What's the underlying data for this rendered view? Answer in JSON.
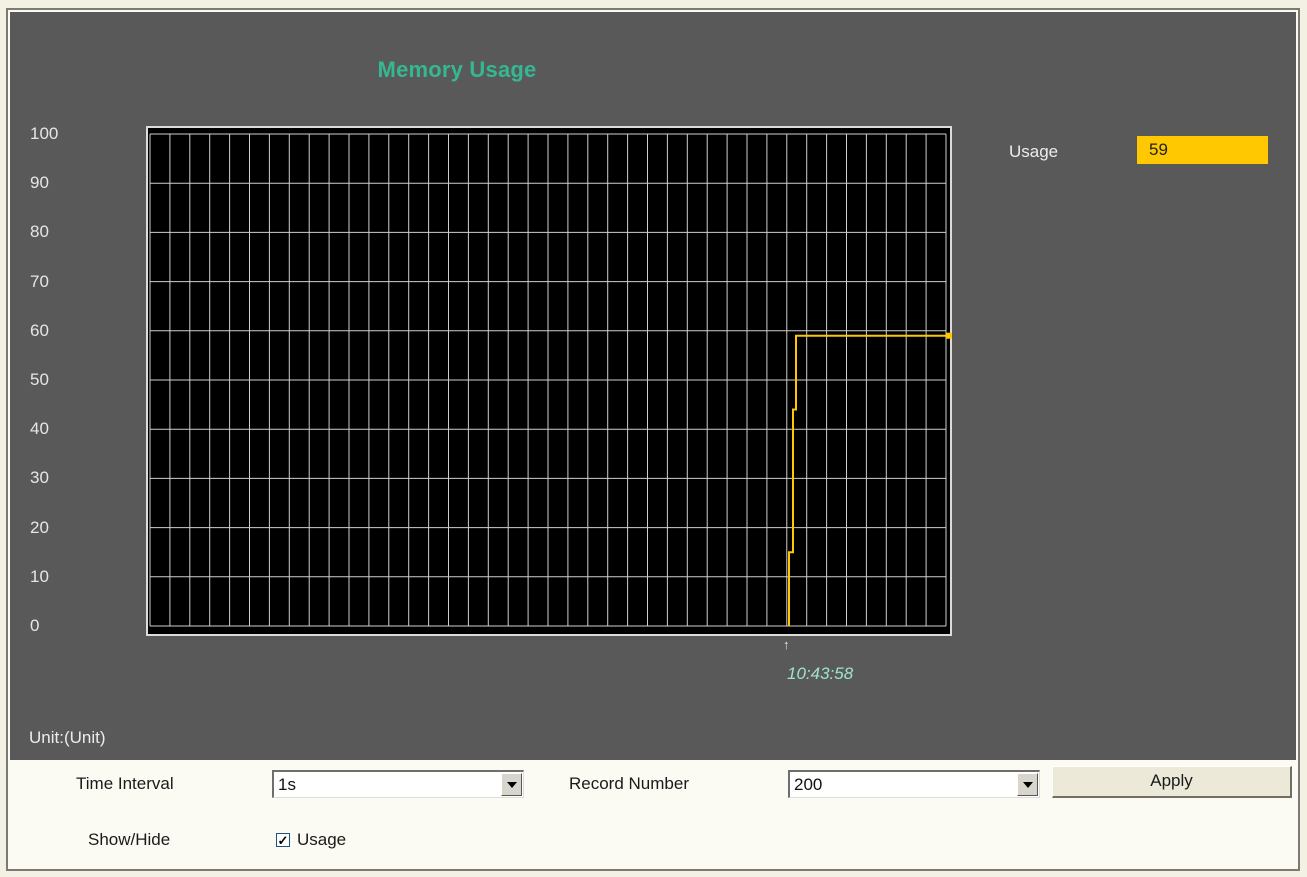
{
  "chart_data": {
    "type": "line",
    "title": "Memory Usage",
    "ylim": [
      0,
      100
    ],
    "yticks": [
      "100",
      "90",
      "80",
      "70",
      "60",
      "50",
      "40",
      "30",
      "20",
      "10",
      "0"
    ],
    "grid": true,
    "series": [
      {
        "name": "Usage",
        "color": "#ffc800",
        "values": [
          0,
          15,
          44,
          59,
          59
        ]
      }
    ],
    "x_marker_label": "10:43:58",
    "legend_placement": "top-right"
  },
  "legend": {
    "label": "Usage",
    "value": "59"
  },
  "unit": "Unit:(Unit)",
  "controls": {
    "time_interval_label": "Time Interval",
    "time_interval_value": "1s",
    "record_number_label": "Record Number",
    "record_number_value": "200",
    "apply_label": "Apply",
    "show_hide_label": "Show/Hide",
    "usage_checkbox_label": "Usage",
    "usage_checked": true
  },
  "icons": {
    "dropdown": "chevron-down-icon",
    "check": "check-icon",
    "marker": "arrow-up-icon"
  }
}
